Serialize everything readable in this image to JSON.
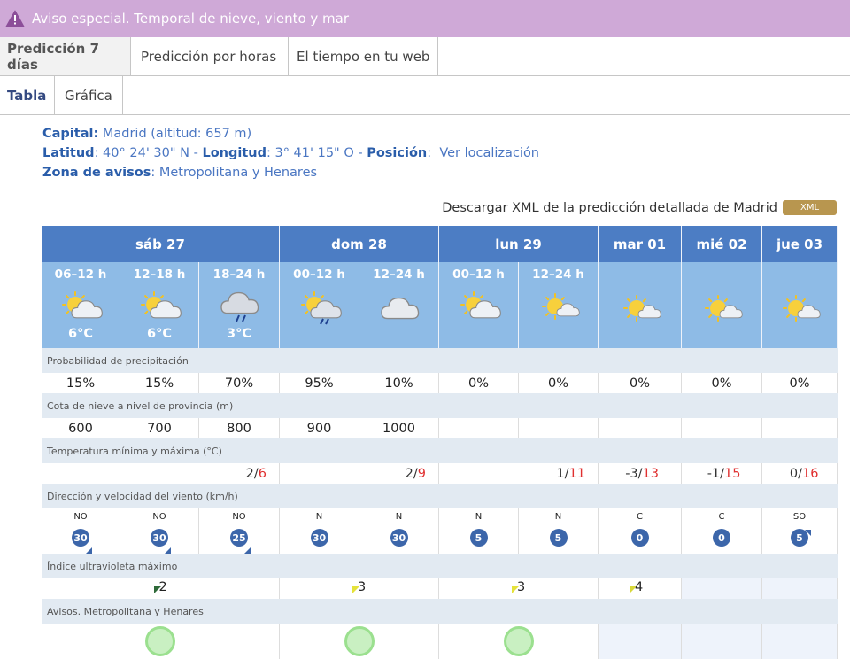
{
  "alert": {
    "text": "Aviso especial. Temporal de nieve, viento y mar",
    "icon": "warning-icon",
    "bg": "#cfa9d7"
  },
  "tabs_main": [
    "Predicción 7 días",
    "Predicción por horas",
    "El tiempo en tu web"
  ],
  "tabs_sub": [
    "Tabla",
    "Gráfica"
  ],
  "info": {
    "capital_label": "Capital:",
    "capital_value": " Madrid (altitud: 657 m)",
    "lat_label": "Latitud",
    "lat_value": ": 40° 24' 30\" N - ",
    "lon_label": "Longitud",
    "lon_value": ": 3° 41' 15\" O - ",
    "pos_label": "Posición",
    "pos_sep": ":",
    "pos_link": "Ver localización",
    "zona_label": "Zona de avisos",
    "zona_value": ": Metropolitana y Henares"
  },
  "xml": {
    "text": "Descargar XML de la predicción detallada de Madrid",
    "button": "XML"
  },
  "days": [
    "sáb 27",
    "dom 28",
    "lun 29",
    "mar 01",
    "mié 02",
    "jue 03"
  ],
  "periods": [
    "06–12 h",
    "12–18 h",
    "18–24 h",
    "00–12 h",
    "12–24 h",
    "00–12 h",
    "12–24 h",
    "",
    "",
    ""
  ],
  "sky_icons": [
    "sun-cloud-icon",
    "sun-cloud-icon",
    "rain-cloud-icon",
    "sun-rain-cloud-icon",
    "cloud-icon",
    "sun-cloud-icon",
    "sun-small-cloud-icon",
    "sun-small-cloud-icon",
    "sun-small-cloud-icon",
    "sun-small-cloud-icon"
  ],
  "temps": [
    "6°C",
    "6°C",
    "3°C",
    "",
    "",
    "",
    "",
    "",
    "",
    ""
  ],
  "sections": {
    "precip": "Probabilidad de precipitación",
    "snow": "Cota de nieve a nivel de provincia (m)",
    "temp": "Temperatura mínima y máxima (°C)",
    "wind": "Dirección y velocidad del viento (km/h)",
    "uv": "Índice ultravioleta máximo",
    "avisos": "Avisos. Metropolitana y Henares"
  },
  "precip": [
    "15%",
    "15%",
    "70%",
    "95%",
    "10%",
    "0%",
    "0%",
    "0%",
    "0%",
    "0%"
  ],
  "snow": [
    "600",
    "700",
    "800",
    "900",
    "1000",
    "",
    "",
    "",
    "",
    ""
  ],
  "tminmax": [
    {
      "min": "2",
      "sep": " / ",
      "max": "6"
    },
    {
      "min": "2",
      "sep": " / ",
      "max": "9"
    },
    {
      "min": "1",
      "sep": " / ",
      "max": "11"
    },
    {
      "min": "-3",
      "sep": " / ",
      "max": "13"
    },
    {
      "min": "-1",
      "sep": " / ",
      "max": "15"
    },
    {
      "min": "0",
      "sep": " / ",
      "max": "16"
    }
  ],
  "wind": [
    {
      "dir": "NO",
      "speed": "30"
    },
    {
      "dir": "NO",
      "speed": "30"
    },
    {
      "dir": "NO",
      "speed": "25"
    },
    {
      "dir": "N",
      "speed": "30"
    },
    {
      "dir": "N",
      "speed": "30"
    },
    {
      "dir": "N",
      "speed": "5"
    },
    {
      "dir": "N",
      "speed": "5"
    },
    {
      "dir": "C",
      "speed": "0"
    },
    {
      "dir": "C",
      "speed": "0"
    },
    {
      "dir": "SO",
      "speed": "5"
    }
  ],
  "uv": [
    "2",
    "3",
    "3",
    "4",
    "",
    ""
  ],
  "colors": {
    "day_header": "#4c7dc4",
    "period_bg": "#8ebbe6",
    "section_bg": "#e2eaf2",
    "tmax": "#e03030",
    "wind_circle": "#3c66aa",
    "aviso_green": "#c9f0c2"
  }
}
